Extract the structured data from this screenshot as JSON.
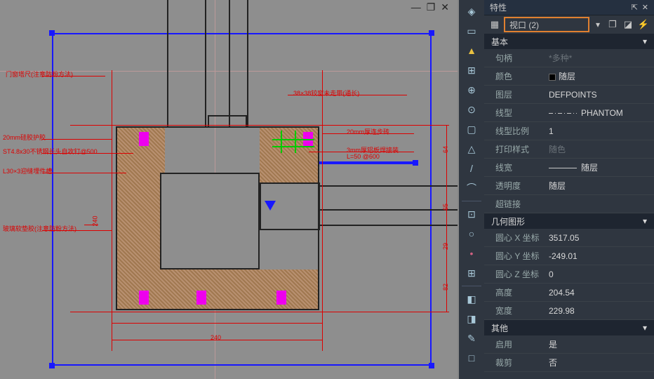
{
  "titlebar": {
    "min": "—",
    "restore": "❐",
    "close": "✕"
  },
  "panel": {
    "title": "特性",
    "pin_icon": "⇱",
    "close_icon": "✕",
    "selection": "视口 (2)",
    "selection_drop": "▾",
    "sections": {
      "basic": {
        "label": "基本",
        "arrow": "▾"
      },
      "geom": {
        "label": "几何图形",
        "arrow": "▾"
      },
      "misc": {
        "label": "其他",
        "arrow": "▾"
      }
    },
    "props": {
      "handle": {
        "k": "句柄",
        "v": "*多种*"
      },
      "color": {
        "k": "颜色",
        "v": "随层"
      },
      "layer": {
        "k": "图层",
        "v": "DEFPOINTS"
      },
      "linetype": {
        "k": "线型",
        "v": "PHANTOM"
      },
      "ltscale": {
        "k": "线型比例",
        "v": "1"
      },
      "plotstyle": {
        "k": "打印样式",
        "v": "随色"
      },
      "lineweight": {
        "k": "线宽",
        "v": "随层"
      },
      "transparency": {
        "k": "透明度",
        "v": "随层"
      },
      "hyperlink": {
        "k": "超链接",
        "v": ""
      },
      "centerx": {
        "k": "圆心 X 坐标",
        "v": "3517.05"
      },
      "centery": {
        "k": "圆心 Y 坐标",
        "v": "-249.01"
      },
      "centerz": {
        "k": "圆心 Z 坐标",
        "v": "0"
      },
      "height": {
        "k": "高度",
        "v": "204.54"
      },
      "width": {
        "k": "宽度",
        "v": "229.98"
      },
      "on": {
        "k": "启用",
        "v": "是"
      },
      "clipped": {
        "k": "裁剪",
        "v": "否"
      }
    }
  },
  "annotations": {
    "a1": "门窗塔尺(注意防粉方法)",
    "a2": "20mm硅胶护胶",
    "a3": "ST4.8x30不锈钢长头自攻钉@500",
    "a4": "L30×3迎缝埋件槽",
    "a5": "玻璃软垫胶(注意防粉方法)",
    "a6": "38×38铰窗未走带(通长)",
    "a7": "20mm厚连步砖",
    "a8": "3mm厚铝板焊接装",
    "a9": "L=50 @600",
    "d_240": "240",
    "d_240b": "240",
    "d_64": "64",
    "d_65": "65",
    "d_29": "29",
    "d_82": "82"
  },
  "toolbar_icons": [
    "◈",
    "▭",
    "▲",
    "⊞",
    "⊕",
    "⊙",
    "▢",
    "△",
    "/",
    "⌒",
    "⊡",
    "○",
    "•",
    "⊞",
    "◧",
    "◨",
    "✎",
    "□"
  ],
  "chart_data": null
}
